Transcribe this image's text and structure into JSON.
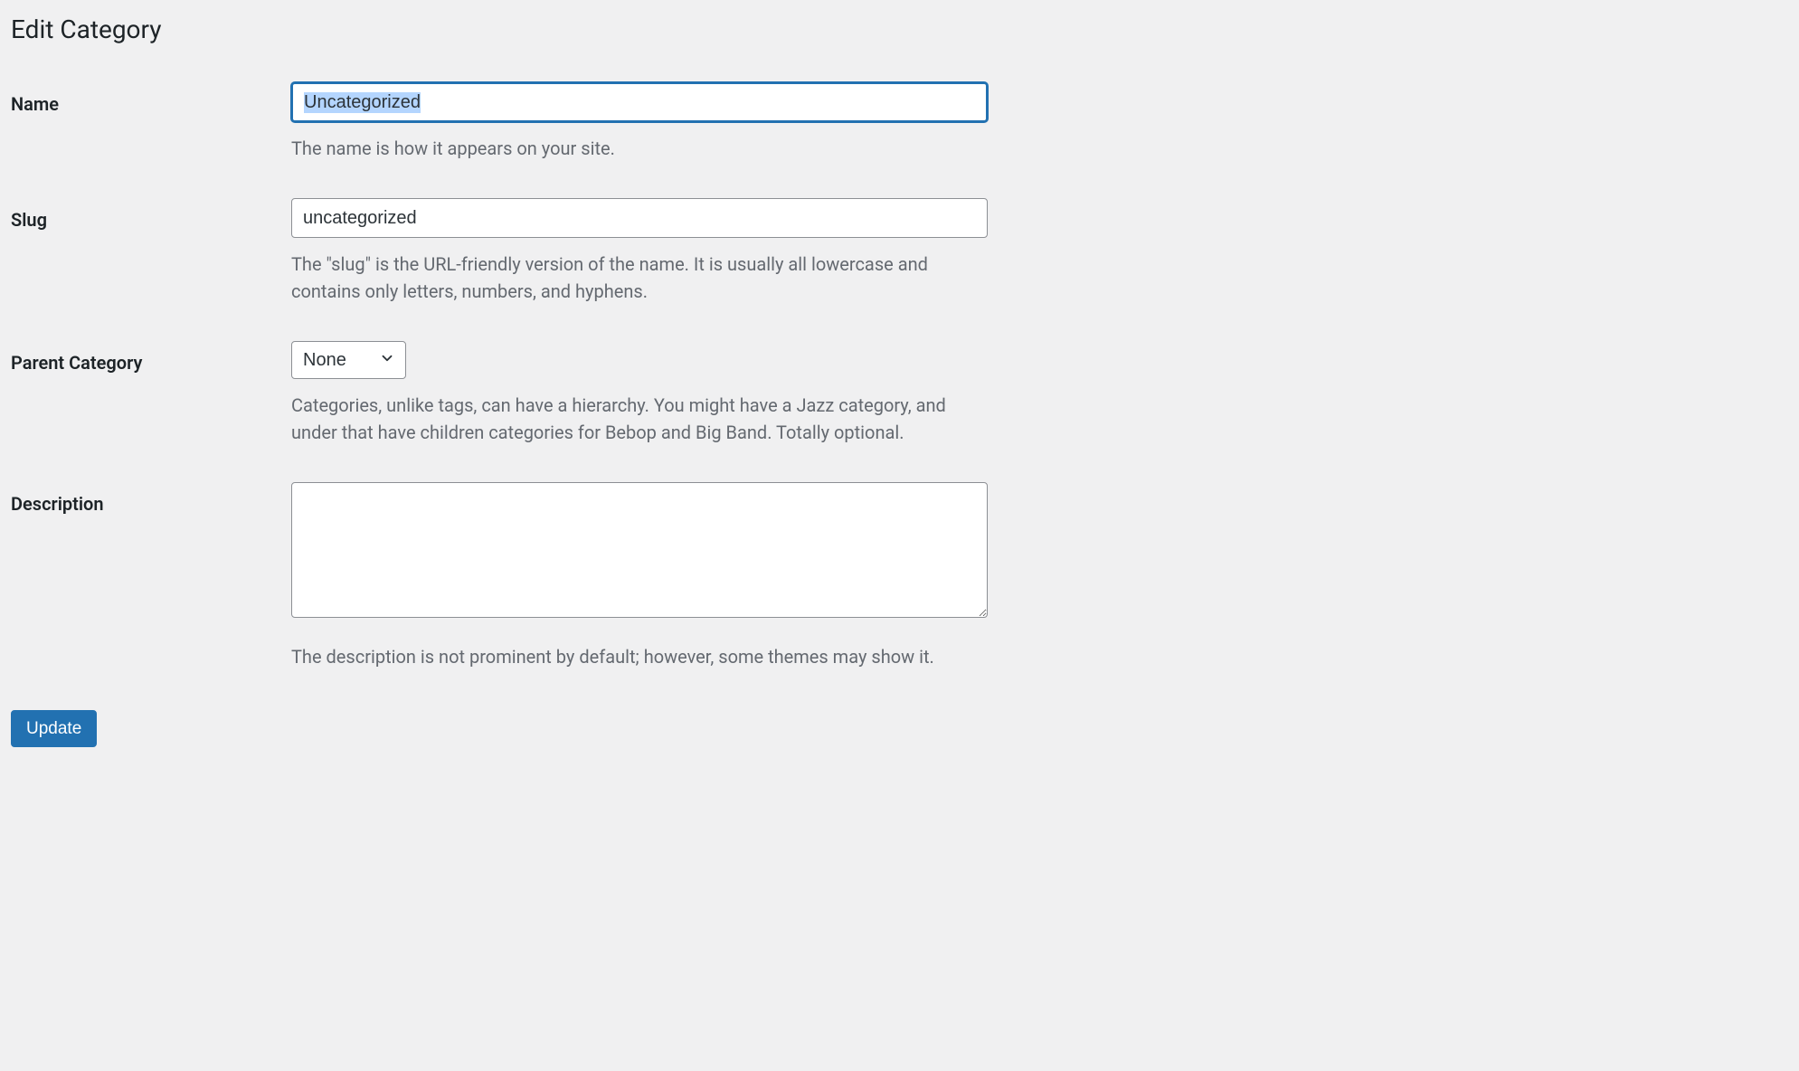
{
  "page": {
    "title": "Edit Category"
  },
  "fields": {
    "name": {
      "label": "Name",
      "value": "Uncategorized",
      "description": "The name is how it appears on your site."
    },
    "slug": {
      "label": "Slug",
      "value": "uncategorized",
      "description": "The \"slug\" is the URL-friendly version of the name. It is usually all lowercase and contains only letters, numbers, and hyphens."
    },
    "parent": {
      "label": "Parent Category",
      "selected": "None",
      "description": "Categories, unlike tags, can have a hierarchy. You might have a Jazz category, and under that have children categories for Bebop and Big Band. Totally optional."
    },
    "description": {
      "label": "Description",
      "value": "",
      "description": "The description is not prominent by default; however, some themes may show it."
    }
  },
  "actions": {
    "update_label": "Update"
  }
}
